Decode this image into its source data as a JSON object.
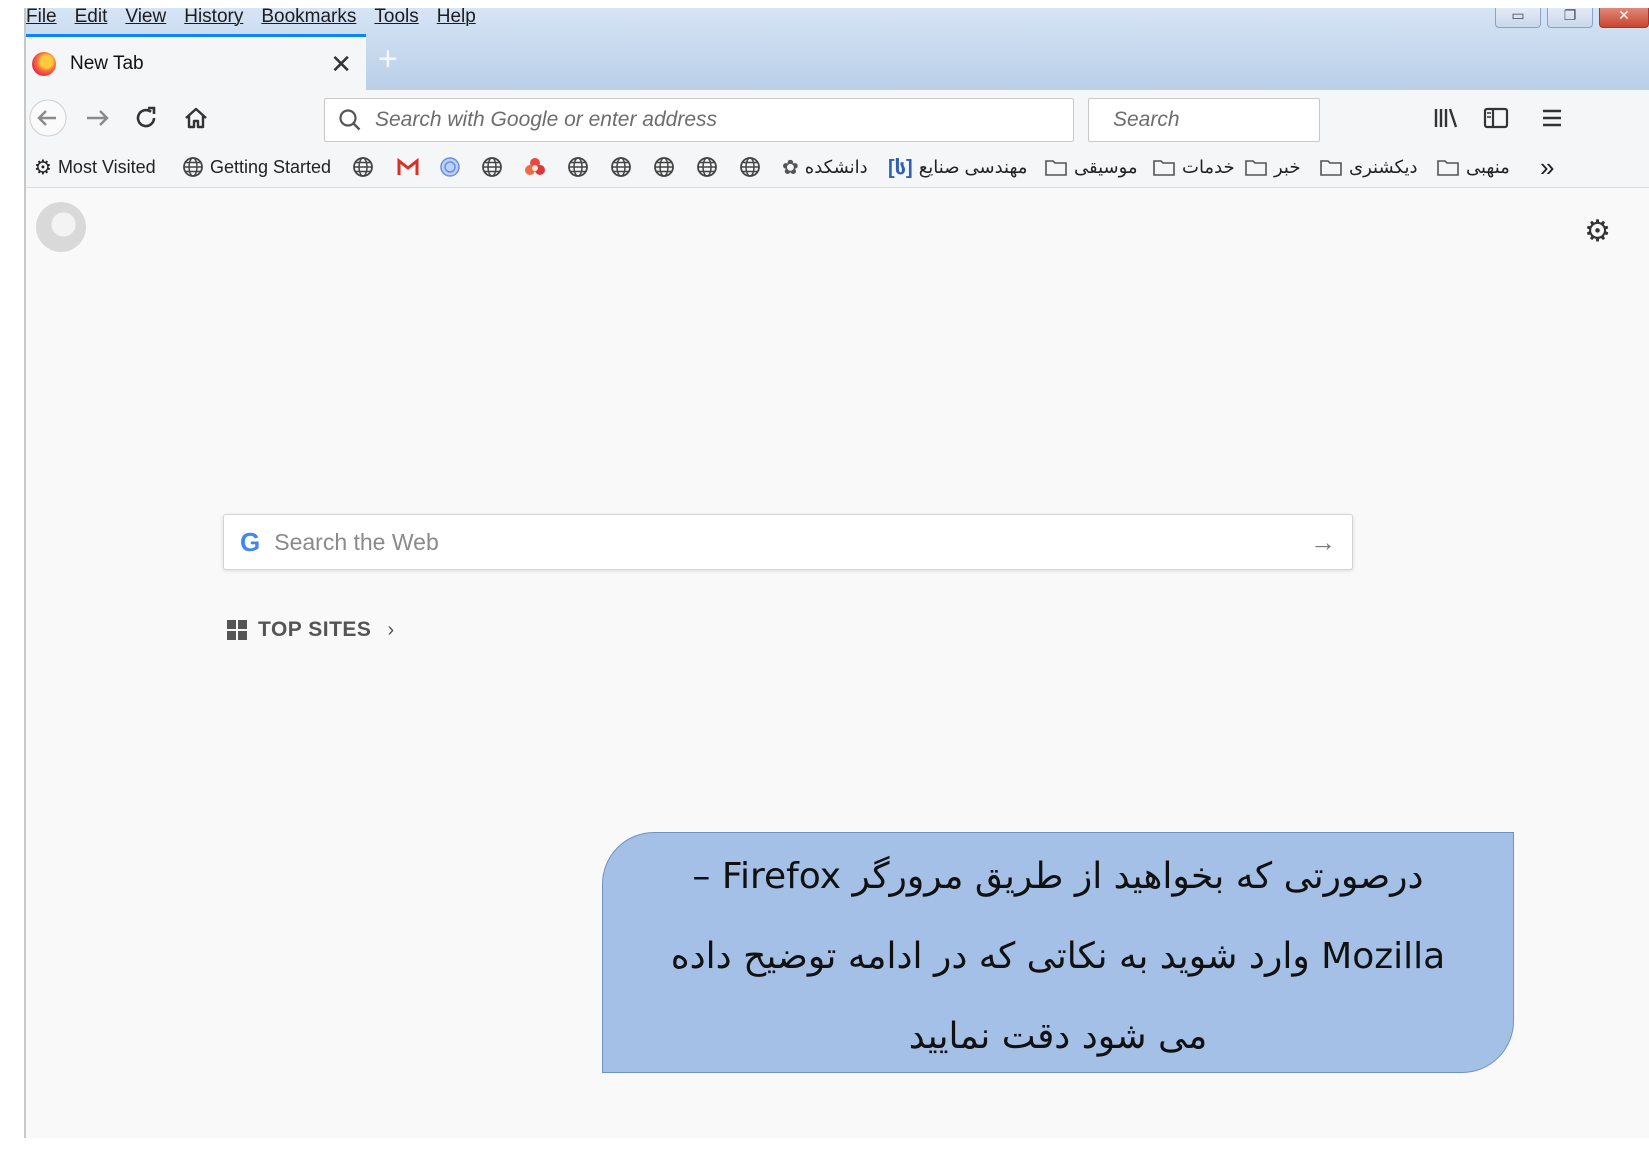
{
  "menubar": [
    "File",
    "Edit",
    "View",
    "History",
    "Bookmarks",
    "Tools",
    "Help"
  ],
  "window_controls": [
    "minimize",
    "restore",
    "close"
  ],
  "tab": {
    "title": "New Tab",
    "close": "✕",
    "new_tab": "+"
  },
  "navbar": {
    "url_placeholder": "Search with Google or enter address",
    "search_placeholder": "Search"
  },
  "bookmarks": {
    "most_visited": "Most Visited",
    "getting_started": "Getting Started",
    "faculty": "دانشکده",
    "industrial_engineering": "مهندسی صنایع",
    "music": "موسیقی",
    "services": "خدمات",
    "news": "خبر",
    "dictionary": "دیکشنری",
    "religious": "منهبی",
    "overflow": "»"
  },
  "content": {
    "web_search_placeholder": "Search the Web",
    "top_sites_label": "TOP SITES"
  },
  "callout": {
    "line1": "درصورتی که بخواهید از طریق مرورگر Firefox –",
    "line2": "Mozilla وارد شوید به نکاتی که در ادامه توضیح داده",
    "line3": "می شود دقت نمایید"
  },
  "colors": {
    "accent_tab": "#0a84ff",
    "callout_bg": "#a4c0e6",
    "titlebar": "#c6d8ee"
  }
}
